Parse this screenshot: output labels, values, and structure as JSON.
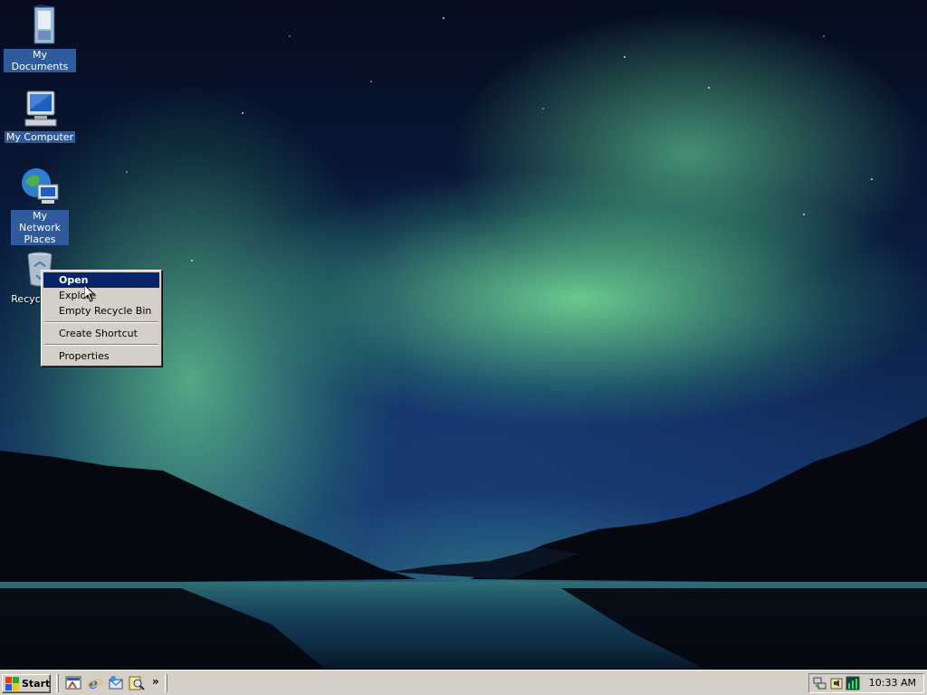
{
  "desktop": {
    "icons": [
      {
        "label": "My Documents"
      },
      {
        "label": "My Computer"
      },
      {
        "label": "My Network Places"
      },
      {
        "label": "Recycle Bin"
      }
    ]
  },
  "context_menu": {
    "items": [
      {
        "label": "Open",
        "bold": true,
        "highlighted": true
      },
      {
        "label": "Explore"
      },
      {
        "label": "Empty Recycle Bin"
      },
      {
        "label": "Create Shortcut"
      },
      {
        "label": "Properties"
      }
    ]
  },
  "taskbar": {
    "start_label": "Start",
    "quick_launch": [
      "show-desktop-icon",
      "internet-explorer-icon",
      "outlook-express-icon",
      "search-icon"
    ],
    "chevron": "»",
    "tray_icons": [
      "network-icon",
      "volume-icon",
      "task-manager-icon"
    ],
    "clock": "10:33 AM"
  },
  "colors": {
    "menu_highlight": "#0a246a",
    "taskbar_face": "#d4d0c8",
    "icon_label_bg": "#2f5a9c"
  }
}
